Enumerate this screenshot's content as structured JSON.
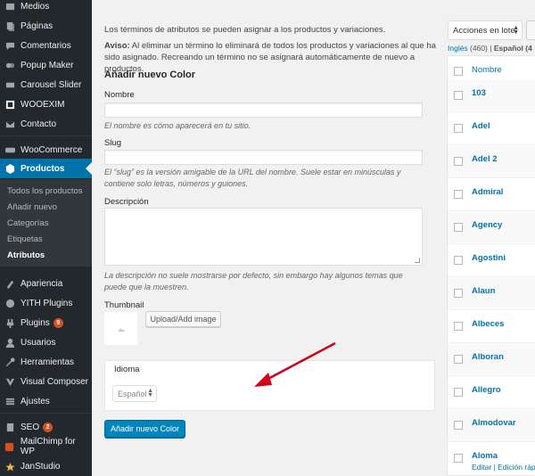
{
  "sidebar": {
    "items": [
      {
        "label": "Medios",
        "icon": "media-icon"
      },
      {
        "label": "Páginas",
        "icon": "pages-icon"
      },
      {
        "label": "Comentarios",
        "icon": "comments-icon"
      },
      {
        "label": "Popup Maker",
        "icon": "popup-icon"
      },
      {
        "label": "Carousel Slider",
        "icon": "slider-icon"
      },
      {
        "label": "WOOEXIM",
        "icon": "wooexim-icon"
      },
      {
        "label": "Contacto",
        "icon": "mail-icon"
      },
      {
        "label": "WooCommerce",
        "icon": "woocommerce-icon"
      },
      {
        "label": "Productos",
        "icon": "products-icon"
      },
      {
        "label": "Apariencia",
        "icon": "appearance-icon"
      },
      {
        "label": "YITH Plugins",
        "icon": "yith-icon"
      },
      {
        "label": "Plugins",
        "icon": "plugins-icon",
        "badge": "9"
      },
      {
        "label": "Usuarios",
        "icon": "users-icon"
      },
      {
        "label": "Herramientas",
        "icon": "tools-icon"
      },
      {
        "label": "Visual Composer",
        "icon": "vc-icon"
      },
      {
        "label": "Ajustes",
        "icon": "settings-icon"
      },
      {
        "label": "SEO",
        "icon": "seo-icon",
        "badge": "2"
      },
      {
        "label": "MailChimp for WP",
        "icon": "mailchimp-icon"
      },
      {
        "label": "JanStudio",
        "icon": "janstudio-icon"
      }
    ],
    "submenu": [
      "Todos los productos",
      "Añadir nuevo",
      "Categorías",
      "Etiquetas",
      "Atributos"
    ]
  },
  "form": {
    "intro": "Los términos de atributos se pueden asignar a los productos y variaciones.",
    "warning_bold": "Aviso:",
    "warning": " Al eliminar un término lo eliminará de todos los productos y variaciones al que ha sido asignado. Recreando un término no se asignará automáticamente de nuevo a productos.",
    "title": "Añadir nuevo Color",
    "name_label": "Nombre",
    "name_help": "El nombre es cómo aparecerá en tu sitio.",
    "slug_label": "Slug",
    "slug_help": "El “slug” es la versión amigable de la URL del nombre. Suele estar en minúsculas y contiene solo letras, números y guiones.",
    "desc_label": "Descripción",
    "desc_help": "La descripción no suele mostrarse por defecto, sin embargo hay algunos temas que puede que la muestren.",
    "thumb_label": "Thumbnail",
    "upload_label": "Upload/Add image",
    "lang_title": "Idioma",
    "lang_value": "Español",
    "submit_label": "Añadir nuevo Color"
  },
  "table": {
    "bulk_label": "Acciones en lote",
    "lang_links": {
      "ingles": "Inglés",
      "ingles_count": " (460) | ",
      "espanol": "Español (4"
    },
    "header": "Nombre",
    "rows": [
      "103",
      "Adel",
      "Adel 2",
      "Admiral",
      "Agency",
      "Agostini",
      "Alaun",
      "Albeces",
      "Alboran",
      "Allegro",
      "Almodovar",
      "Aloma"
    ],
    "row_actions": "Editar | Edición ráp"
  }
}
